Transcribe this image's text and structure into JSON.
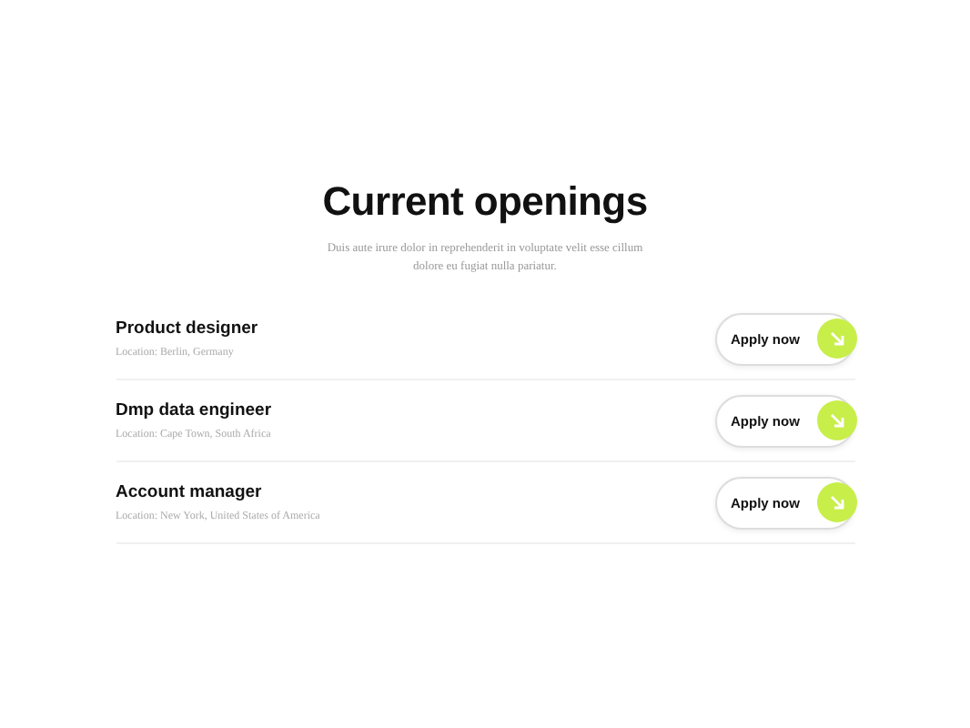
{
  "heading": "Current openings",
  "intro": "Duis aute irure dolor in reprehenderit in voluptate velit esse cillum dolore eu fugiat nulla pariatur.",
  "jobs": [
    {
      "title": "Product designer",
      "location": "Location: Berlin, Germany",
      "button": "Apply now"
    },
    {
      "title": "Dmp data engineer",
      "location": "Location: Cape Town, South Africa",
      "button": "Apply now"
    },
    {
      "title": "Account manager",
      "location": "Location: New York, United States of America",
      "button": "Apply now"
    }
  ]
}
